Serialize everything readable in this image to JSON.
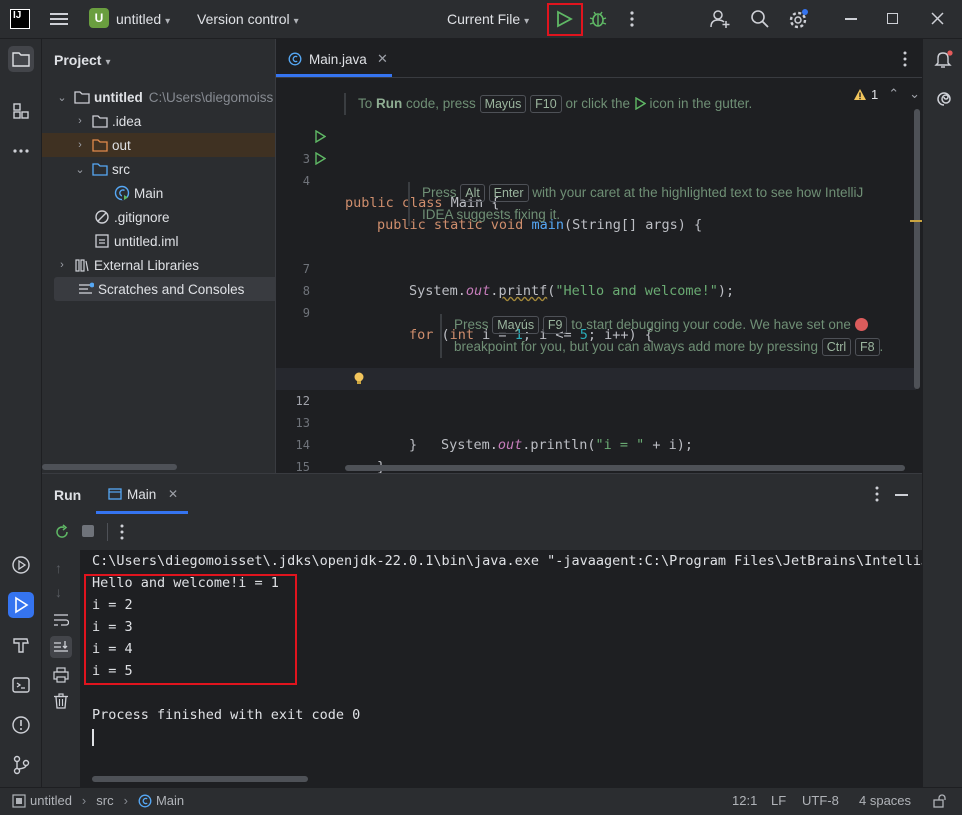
{
  "titlebar": {
    "logo": "IJ",
    "project_badge": "U",
    "project_name": "untitled",
    "vcs": "Version control",
    "run_config": "Current File"
  },
  "project_panel": {
    "title": "Project",
    "items": [
      {
        "label": "untitled",
        "path": "C:\\Users\\diegomoiss"
      },
      {
        "label": ".idea"
      },
      {
        "label": "out"
      },
      {
        "label": "src"
      },
      {
        "label": "Main"
      },
      {
        "label": ".gitignore"
      },
      {
        "label": "untitled.iml"
      },
      {
        "label": "External Libraries"
      },
      {
        "label": "Scratches and Consoles"
      }
    ]
  },
  "editor": {
    "tab": "Main.java",
    "warnings": "1",
    "hint_top": {
      "a": "To ",
      "run": "Run",
      "b": " code, press ",
      "k1": "Mayús",
      "k2": "F10",
      "c": " or click the ",
      "d": " icon in the gutter."
    },
    "hint_mid": {
      "a": "Press ",
      "k1": "Alt",
      "k2": "Enter",
      "b": " with your caret at the highlighted text to see how IntelliJ",
      "c": "IDEA suggests fixing it."
    },
    "hint_debug": {
      "a": "Press ",
      "k1": "Mayús",
      "k2": "F9",
      "b": " to start debugging your code. We have set one ",
      "c": "breakpoint for you, but you can always add more by pressing ",
      "k3": "Ctrl",
      "k4": "F8",
      "d": "."
    },
    "line_numbers": [
      "3",
      "4",
      "7",
      "8",
      "9",
      "12",
      "13",
      "14",
      "15"
    ],
    "code": {
      "l3_kw": "public class ",
      "l3_rest": "Main {",
      "l4_kw": "public static void ",
      "l4_fn": "main",
      "l4_rest": "(String[] args) {",
      "l7_a": "System.",
      "l7_f": "out",
      "l7_b": ".",
      "l7_m": "printf",
      "l7_c": "(",
      "l7_s": "\"Hello and welcome!\"",
      "l7_d": ");",
      "l9_kw": "for",
      "l9_a": " (",
      "l9_kw2": "int",
      "l9_b": " i = ",
      "l9_n1": "1",
      "l9_c": "; i <= ",
      "l9_n2": "5",
      "l9_d": "; i++) {",
      "l12_a": "System.",
      "l12_f": "out",
      "l12_b": ".println(",
      "l12_s": "\"i = \"",
      "l12_c": " + i);",
      "l13": "}",
      "l14": "}",
      "l15": "}"
    }
  },
  "run_panel": {
    "tab_run": "Run",
    "tab_main": "Main",
    "output": [
      "C:\\Users\\diegomoisset\\.jdks\\openjdk-22.0.1\\bin\\java.exe \"-javaagent:C:\\Program Files\\JetBrains\\IntelliJ",
      "Hello and welcome!i = 1",
      "i = 2",
      "i = 3",
      "i = 4",
      "i = 5",
      "",
      "Process finished with exit code 0"
    ]
  },
  "statusbar": {
    "crumb1": "untitled",
    "crumb2": "src",
    "crumb3": "Main",
    "position": "12:1",
    "line_sep": "LF",
    "encoding": "UTF-8",
    "indent": "4 spaces"
  },
  "colors": {
    "accent": "#3574f0",
    "run_green": "#5fb865",
    "highlight_red": "#e0141e"
  }
}
